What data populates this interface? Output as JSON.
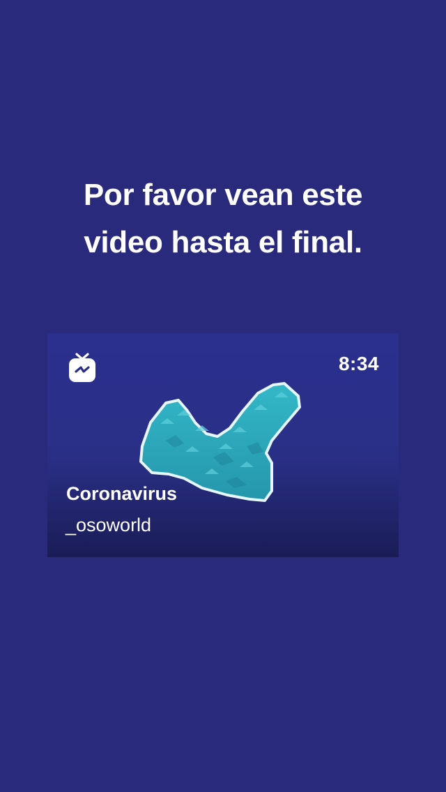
{
  "headline": {
    "line1": "Por favor vean este",
    "line2": "video hasta el final."
  },
  "video": {
    "icon": "igtv-icon",
    "duration": "8:34",
    "title": "Coronavirus",
    "author": "_osoworld"
  },
  "colors": {
    "background": "#2a2a7d",
    "map_fill": "#2fb3c3",
    "text": "#ffffff"
  }
}
